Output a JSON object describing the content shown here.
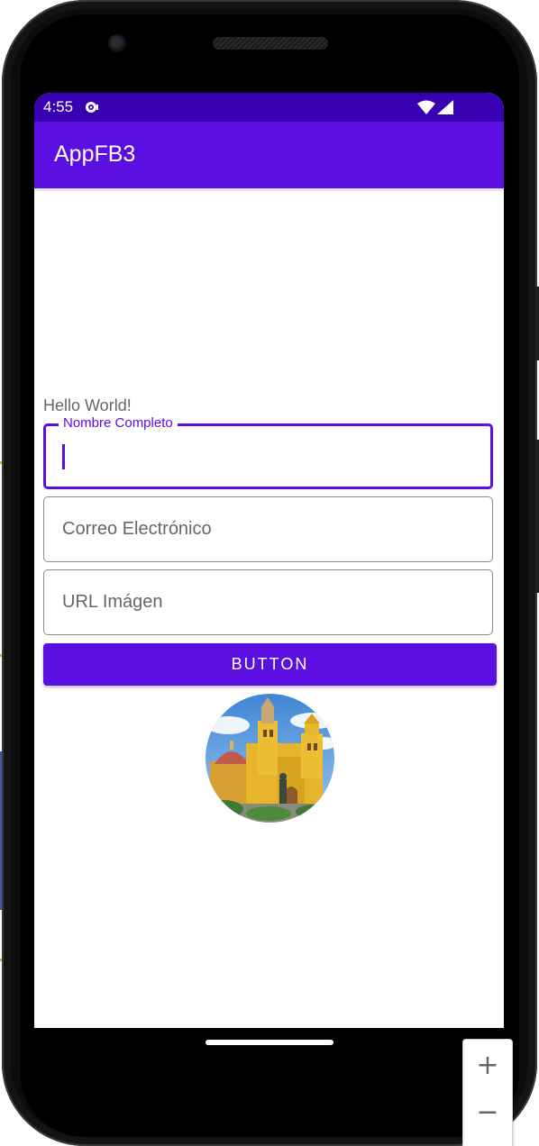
{
  "status_bar": {
    "time": "4:55",
    "background": "#3700b3",
    "notification_icon": "cast-notification-icon",
    "wifi_icon": "wifi-icon",
    "signal_icon": "cell-signal-icon"
  },
  "app_bar": {
    "title": "AppFB3",
    "background": "#5b0fe0"
  },
  "content": {
    "hello_text": "Hello World!",
    "fields": [
      {
        "label": "Nombre Completo",
        "value": "",
        "focused": true
      },
      {
        "label": "Correo Electrónico",
        "value": "",
        "focused": false
      },
      {
        "label": "URL Imágen",
        "value": "",
        "focused": false
      }
    ],
    "button_label": "BUTTON",
    "image": "church-photo (yellow cathedral with blue sky)"
  },
  "emulator": {
    "zoom_in_label": "+",
    "zoom_out_label": "−"
  },
  "colors": {
    "accent": "#5b0fe0",
    "status": "#3700b3"
  }
}
